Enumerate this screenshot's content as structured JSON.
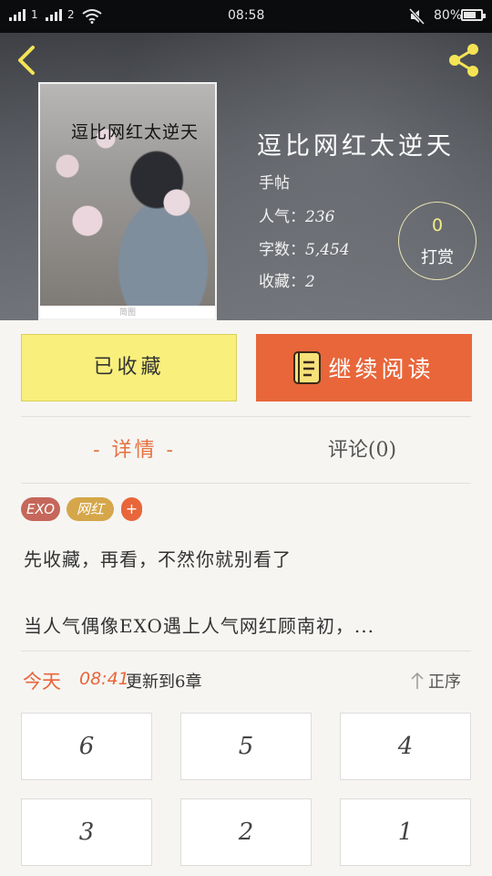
{
  "status_bar": {
    "time": "08:58",
    "battery": "80%",
    "battery_level": 0.8,
    "sim_label": "2"
  },
  "book": {
    "cover_title": "逗比网红太逆天",
    "cover_caption": "简图",
    "title": "逗比网红太逆天",
    "author": "手帖",
    "popularity_label": "人气：",
    "popularity": "236",
    "words_label": "字数：",
    "words": "5,454",
    "favorites_label": "收藏：",
    "favorites": "2"
  },
  "tip": {
    "count": "0",
    "label": "打赏"
  },
  "actions": {
    "collected_label": "已收藏",
    "continue_label": "继续阅读"
  },
  "tabs": {
    "detail": "- 详情 -",
    "comments": "评论(0)"
  },
  "tags": [
    "EXO",
    "网红",
    "+"
  ],
  "description": {
    "line1": "先收藏，再看，不然你就别看了",
    "line2": "当人气偶像EXO遇上人气网红顾南初，..."
  },
  "update": {
    "today": "今天",
    "time": "08:41",
    "text": "更新到6章",
    "sort_label": "正序"
  },
  "chapters": [
    "6",
    "5",
    "4",
    "3",
    "2",
    "1"
  ],
  "colors": {
    "accent": "#e8663a",
    "collect_bg": "#f9ef7c",
    "tip_count": "#f4ec86",
    "icon_yellow": "#f5e356"
  }
}
